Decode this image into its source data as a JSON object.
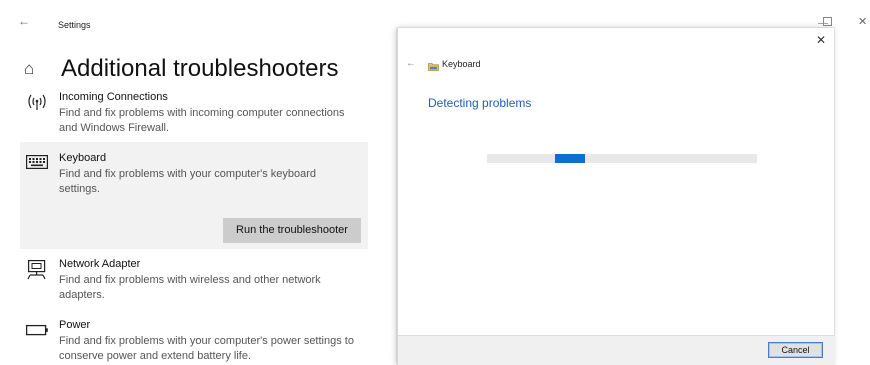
{
  "settings": {
    "app_title": "Settings",
    "page_title": "Additional troubleshooters",
    "items": [
      {
        "title": "Incoming Connections",
        "description": "Find and fix problems with incoming computer connections and Windows Firewall.",
        "icon": "incoming-connections-icon"
      },
      {
        "title": "Keyboard",
        "description": "Find and fix problems with your computer's keyboard settings.",
        "icon": "keyboard-icon",
        "selected": true,
        "action_label": "Run the troubleshooter"
      },
      {
        "title": "Network Adapter",
        "description": "Find and fix problems with wireless and other network adapters.",
        "icon": "network-adapter-icon"
      },
      {
        "title": "Power",
        "description": "Find and fix problems with your computer's power settings to conserve power and extend battery life.",
        "icon": "power-icon"
      }
    ]
  },
  "dialog": {
    "title": "Keyboard",
    "heading": "Detecting problems",
    "progress_indeterminate": true,
    "progress_chunk_start": 0.25,
    "progress_chunk_fraction": 0.11,
    "cancel_label": "Cancel"
  },
  "colors": {
    "accent": "#0f6fd1",
    "heading": "#1d5fb5",
    "selected_bg": "#f2f2f2",
    "button_bg": "#cccccc"
  }
}
